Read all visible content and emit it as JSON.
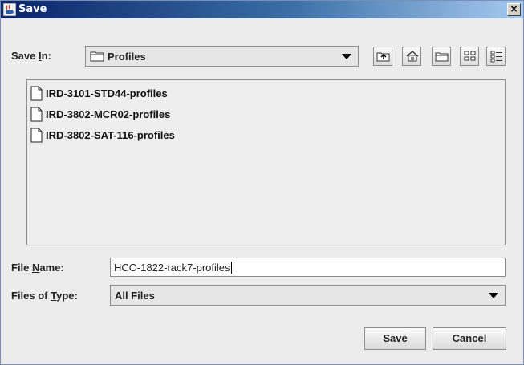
{
  "titlebar": {
    "title": "Save",
    "close_glyph": "×",
    "icon": "java-cup-icon"
  },
  "save_in": {
    "label_pre": "Save ",
    "label_mnemonic": "I",
    "label_post": "n:",
    "value": "Profiles",
    "folder_icon": "folder-icon"
  },
  "toolbar": {
    "buttons": [
      {
        "name": "up-one-level-button",
        "icon": "up-folder-icon"
      },
      {
        "name": "home-button",
        "icon": "home-icon"
      },
      {
        "name": "new-folder-button",
        "icon": "new-folder-icon"
      },
      {
        "name": "list-view-button",
        "icon": "list-view-icon"
      },
      {
        "name": "details-view-button",
        "icon": "details-view-icon"
      }
    ]
  },
  "files": [
    {
      "name": "IRD-3101-STD44-profiles"
    },
    {
      "name": "IRD-3802-MCR02-profiles"
    },
    {
      "name": "IRD-3802-SAT-116-profiles"
    }
  ],
  "file_name": {
    "label_pre": "File ",
    "label_mnemonic": "N",
    "label_post": "ame:",
    "value": "HCO-1822-rack7-profiles"
  },
  "file_type": {
    "label_pre": "Files of ",
    "label_mnemonic": "T",
    "label_post": "ype:",
    "value": "All Files"
  },
  "buttons": {
    "save": "Save",
    "cancel": "Cancel"
  },
  "colors": {
    "title_start": "#0a246a",
    "title_end": "#a6caf0",
    "panel_bg": "#ececec"
  }
}
